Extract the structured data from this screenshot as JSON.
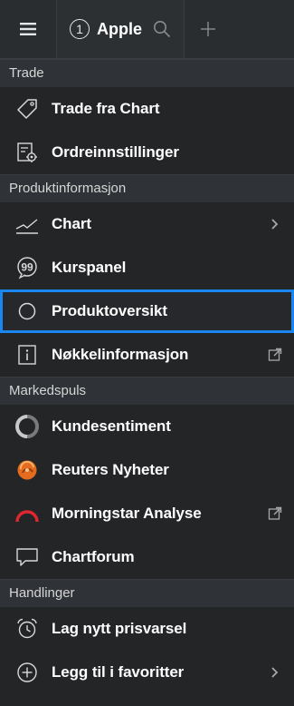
{
  "colors": {
    "accent": "#1a86f0",
    "background": "#232527",
    "section_bg": "#2f3236"
  },
  "topbar": {
    "menu_icon": "hamburger-icon",
    "tab": {
      "number": "1",
      "label": "Apple",
      "icon": "search-icon"
    },
    "add_icon": "plus-icon"
  },
  "sections": [
    {
      "title": "Trade",
      "items": [
        {
          "label": "Trade fra Chart",
          "icon": "tag-icon"
        },
        {
          "label": "Ordreinnstillinger",
          "icon": "order-settings-icon"
        }
      ]
    },
    {
      "title": "Produktinformasjon",
      "items": [
        {
          "label": "Chart",
          "icon": "chart-line-icon",
          "trailing": "chevron-right-icon"
        },
        {
          "label": "Kurspanel",
          "icon": "quote-bubble-icon"
        },
        {
          "label": "Produktoversikt",
          "icon": "circle-icon",
          "selected": true
        },
        {
          "label": "Nøkkelinformasjon",
          "icon": "info-icon",
          "trailing": "external-link-icon"
        }
      ]
    },
    {
      "title": "Markedspuls",
      "items": [
        {
          "label": "Kundesentiment",
          "icon": "sentiment-icon"
        },
        {
          "label": "Reuters Nyheter",
          "icon": "reuters-logo-icon"
        },
        {
          "label": "Morningstar Analyse",
          "icon": "morningstar-logo-icon",
          "trailing": "external-link-icon"
        },
        {
          "label": "Chartforum",
          "icon": "chat-bubble-icon"
        }
      ]
    },
    {
      "title": "Handlinger",
      "items": [
        {
          "label": "Lag nytt prisvarsel",
          "icon": "alarm-clock-icon"
        },
        {
          "label": "Legg til i favoritter",
          "icon": "plus-circle-icon",
          "trailing": "chevron-right-icon"
        }
      ]
    }
  ]
}
